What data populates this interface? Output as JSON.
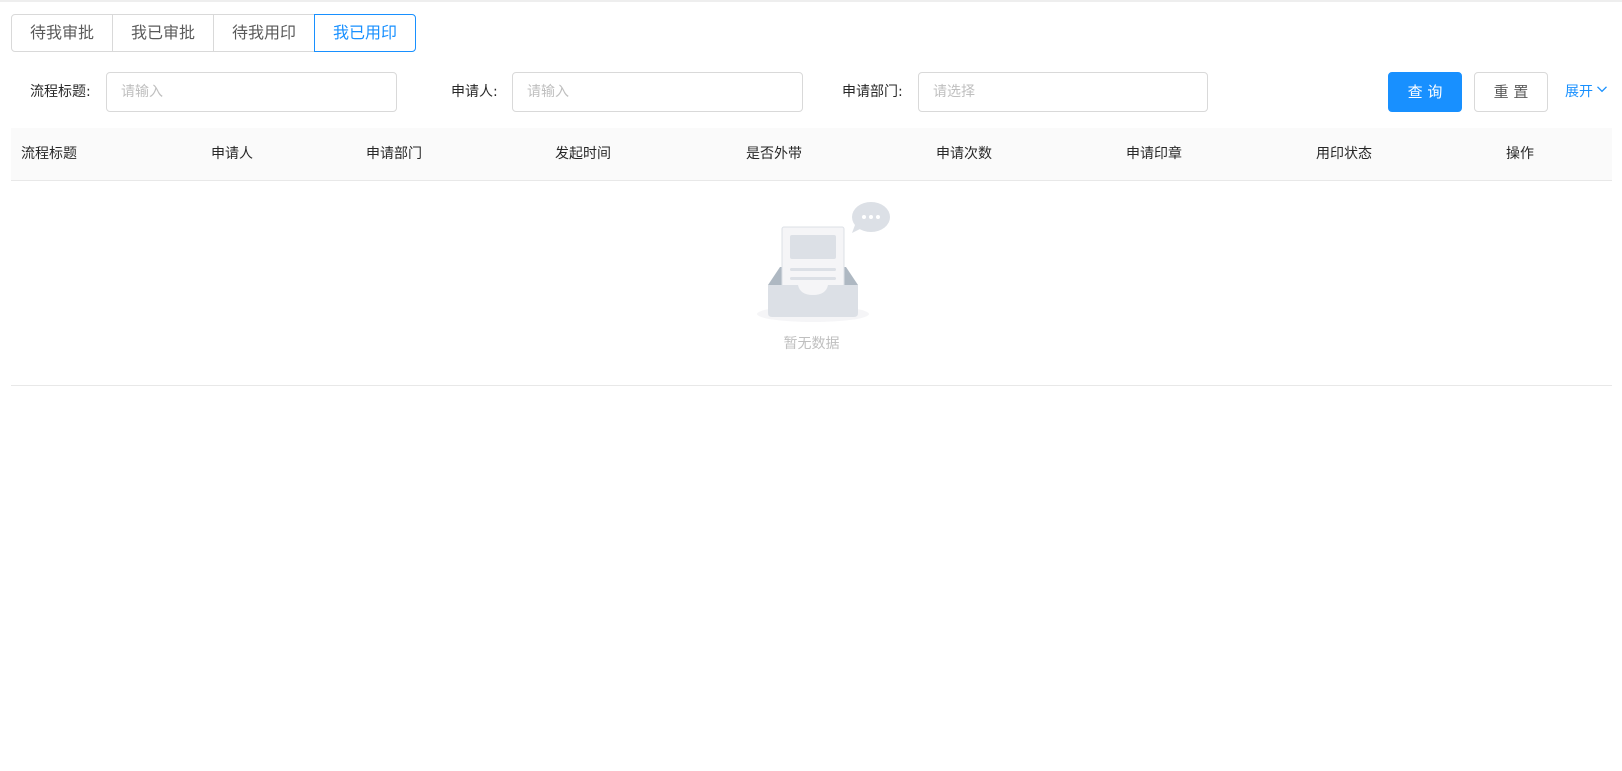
{
  "tabs": [
    {
      "label": "待我审批",
      "active": false
    },
    {
      "label": "我已审批",
      "active": false
    },
    {
      "label": "待我用印",
      "active": false
    },
    {
      "label": "我已用印",
      "active": true
    }
  ],
  "search": {
    "title_label": "流程标题:",
    "title_placeholder": "请输入",
    "applicant_label": "申请人:",
    "applicant_placeholder": "请输入",
    "department_label": "申请部门:",
    "department_placeholder": "请选择",
    "query_button": "查 询",
    "reset_button": "重 置",
    "expand_link": "展开"
  },
  "table": {
    "columns": [
      "流程标题",
      "申请人",
      "申请部门",
      "发起时间",
      "是否外带",
      "申请次数",
      "申请印章",
      "用印状态",
      "操作"
    ],
    "empty_text": "暂无数据"
  },
  "colors": {
    "accent": "#1890ff",
    "border": "#d9d9d9",
    "header_bg": "#fafafa"
  }
}
